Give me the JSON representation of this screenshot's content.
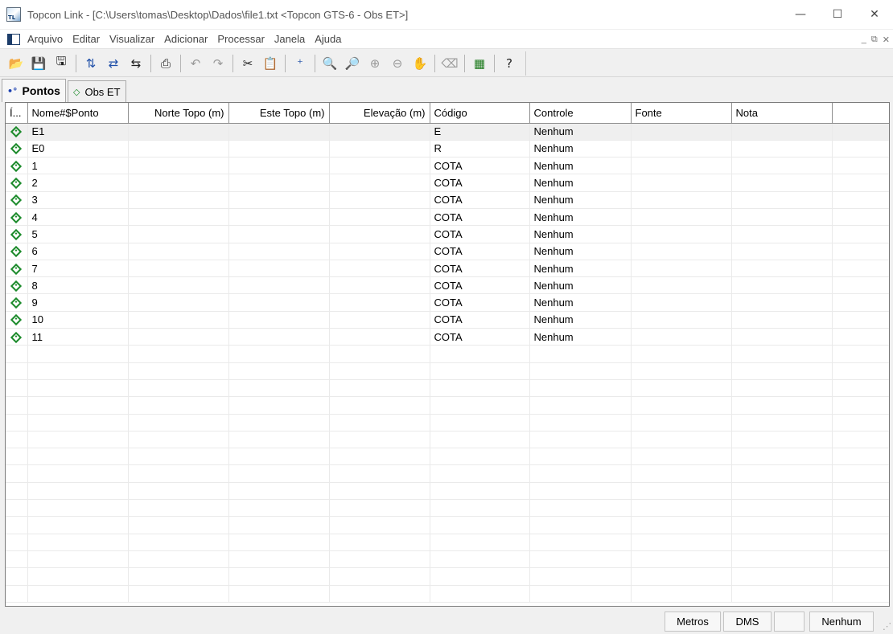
{
  "window": {
    "title": "Topcon Link - [C:\\Users\\tomas\\Desktop\\Dados\\file1.txt  <Topcon GTS-6 - Obs ET>]",
    "icon": "topcon-link-app-icon",
    "controls": {
      "minimize": "—",
      "maximize": "☐",
      "close": "✕"
    }
  },
  "menu": {
    "items": [
      "Arquivo",
      "Editar",
      "Visualizar",
      "Adicionar",
      "Processar",
      "Janela",
      "Ajuda"
    ],
    "mdi_controls": {
      "minimize": "_",
      "restore": "⧉",
      "close": "✕"
    }
  },
  "toolbar": {
    "buttons": [
      {
        "name": "open-icon",
        "glyph": "📂"
      },
      {
        "name": "save-icon",
        "glyph": "💾"
      },
      {
        "name": "save-all-icon",
        "glyph": "🖫"
      },
      {
        "name": "import-points-icon",
        "glyph": "⇅"
      },
      {
        "name": "export-points-icon",
        "glyph": "⇄"
      },
      {
        "name": "convert-icon",
        "glyph": "⇆"
      },
      {
        "name": "print-icon",
        "glyph": "⎙"
      },
      {
        "name": "undo-icon",
        "glyph": "↶"
      },
      {
        "name": "redo-icon",
        "glyph": "↷"
      },
      {
        "name": "cut-icon",
        "glyph": "✂"
      },
      {
        "name": "paste-icon",
        "glyph": "📋"
      },
      {
        "name": "add-point-icon",
        "glyph": "⁺"
      },
      {
        "name": "zoom-in-icon",
        "glyph": "🔍"
      },
      {
        "name": "zoom-out-icon",
        "glyph": "🔎"
      },
      {
        "name": "zoom-window-icon",
        "glyph": "⊕"
      },
      {
        "name": "zoom-extents-icon",
        "glyph": "⊖"
      },
      {
        "name": "pan-hand-icon",
        "glyph": "✋"
      },
      {
        "name": "eraser-icon",
        "glyph": "⌫"
      },
      {
        "name": "calculator-icon",
        "glyph": "▦"
      },
      {
        "name": "help-pointer-icon",
        "glyph": "?"
      }
    ]
  },
  "tabs": [
    {
      "label": "Pontos",
      "icon": "points-tab-icon",
      "active": true
    },
    {
      "label": "Obs ET",
      "icon": "station-obs-tab-icon",
      "active": false
    }
  ],
  "grid": {
    "columns": [
      "Í...",
      "Nome#$Ponto",
      "Norte Topo (m)",
      "Este Topo (m)",
      "Elevação (m)",
      "Código",
      "Controle",
      "Fonte",
      "Nota"
    ],
    "rows": [
      {
        "nome": "E1",
        "norte": "",
        "este": "",
        "elev": "",
        "codigo": "E",
        "controle": "Nenhum",
        "fonte": "",
        "nota": ""
      },
      {
        "nome": "E0",
        "norte": "",
        "este": "",
        "elev": "",
        "codigo": "R",
        "controle": "Nenhum",
        "fonte": "",
        "nota": ""
      },
      {
        "nome": "1",
        "norte": "",
        "este": "",
        "elev": "",
        "codigo": "COTA",
        "controle": "Nenhum",
        "fonte": "",
        "nota": ""
      },
      {
        "nome": "2",
        "norte": "",
        "este": "",
        "elev": "",
        "codigo": "COTA",
        "controle": "Nenhum",
        "fonte": "",
        "nota": ""
      },
      {
        "nome": "3",
        "norte": "",
        "este": "",
        "elev": "",
        "codigo": "COTA",
        "controle": "Nenhum",
        "fonte": "",
        "nota": ""
      },
      {
        "nome": "4",
        "norte": "",
        "este": "",
        "elev": "",
        "codigo": "COTA",
        "controle": "Nenhum",
        "fonte": "",
        "nota": ""
      },
      {
        "nome": "5",
        "norte": "",
        "este": "",
        "elev": "",
        "codigo": "COTA",
        "controle": "Nenhum",
        "fonte": "",
        "nota": ""
      },
      {
        "nome": "6",
        "norte": "",
        "este": "",
        "elev": "",
        "codigo": "COTA",
        "controle": "Nenhum",
        "fonte": "",
        "nota": ""
      },
      {
        "nome": "7",
        "norte": "",
        "este": "",
        "elev": "",
        "codigo": "COTA",
        "controle": "Nenhum",
        "fonte": "",
        "nota": ""
      },
      {
        "nome": "8",
        "norte": "",
        "este": "",
        "elev": "",
        "codigo": "COTA",
        "controle": "Nenhum",
        "fonte": "",
        "nota": ""
      },
      {
        "nome": "9",
        "norte": "",
        "este": "",
        "elev": "",
        "codigo": "COTA",
        "controle": "Nenhum",
        "fonte": "",
        "nota": ""
      },
      {
        "nome": "10",
        "norte": "",
        "este": "",
        "elev": "",
        "codigo": "COTA",
        "controle": "Nenhum",
        "fonte": "",
        "nota": ""
      },
      {
        "nome": "11",
        "norte": "",
        "este": "",
        "elev": "",
        "codigo": "COTA",
        "controle": "Nenhum",
        "fonte": "",
        "nota": ""
      }
    ]
  },
  "statusbar": {
    "units": "Metros",
    "angle": "DMS",
    "empty": "",
    "control": "Nenhum"
  },
  "colors": {
    "point_icon": "#1b8a2a",
    "selected_row": "#efefef"
  }
}
